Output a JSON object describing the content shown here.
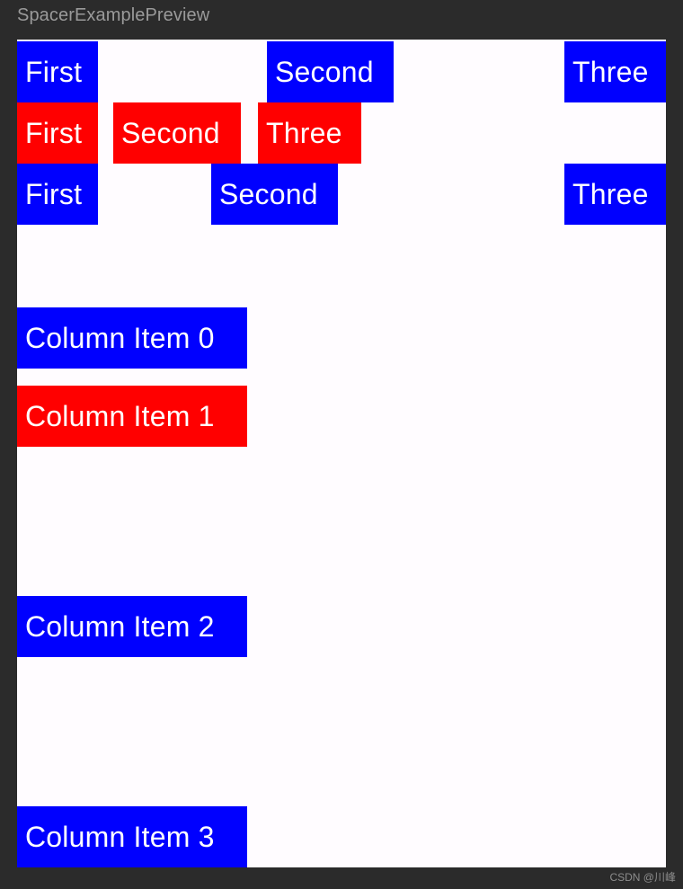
{
  "preview": {
    "title": "SpacerExamplePreview",
    "canvas_bg": "#fffcff",
    "window_bg": "#2b2b2b",
    "title_color": "#9a9a9a"
  },
  "colors": {
    "blue": "#0000FF",
    "red": "#FF0000",
    "text": "#FFFFFF"
  },
  "rows": [
    {
      "id": "row-1",
      "color": "#0000FF",
      "alignment": "space-between",
      "items": [
        {
          "label": "First"
        },
        {
          "label": "Second"
        },
        {
          "label": "Three"
        }
      ]
    },
    {
      "id": "row-2",
      "color": "#FF0000",
      "alignment": "start",
      "items": [
        {
          "label": "First"
        },
        {
          "label": "Second"
        },
        {
          "label": "Three"
        }
      ]
    },
    {
      "id": "row-3",
      "color": "#0000FF",
      "alignment": "space-between",
      "items": [
        {
          "label": "First"
        },
        {
          "label": "Second"
        },
        {
          "label": "Three"
        }
      ]
    }
  ],
  "column": {
    "items": [
      {
        "label": "Column Item 0",
        "color": "#0000FF"
      },
      {
        "label": "Column Item 1",
        "color": "#FF0000"
      },
      {
        "label": "Column Item 2",
        "color": "#0000FF"
      },
      {
        "label": "Column Item 3",
        "color": "#0000FF"
      }
    ]
  },
  "watermark": {
    "text": "CSDN @川峰"
  }
}
